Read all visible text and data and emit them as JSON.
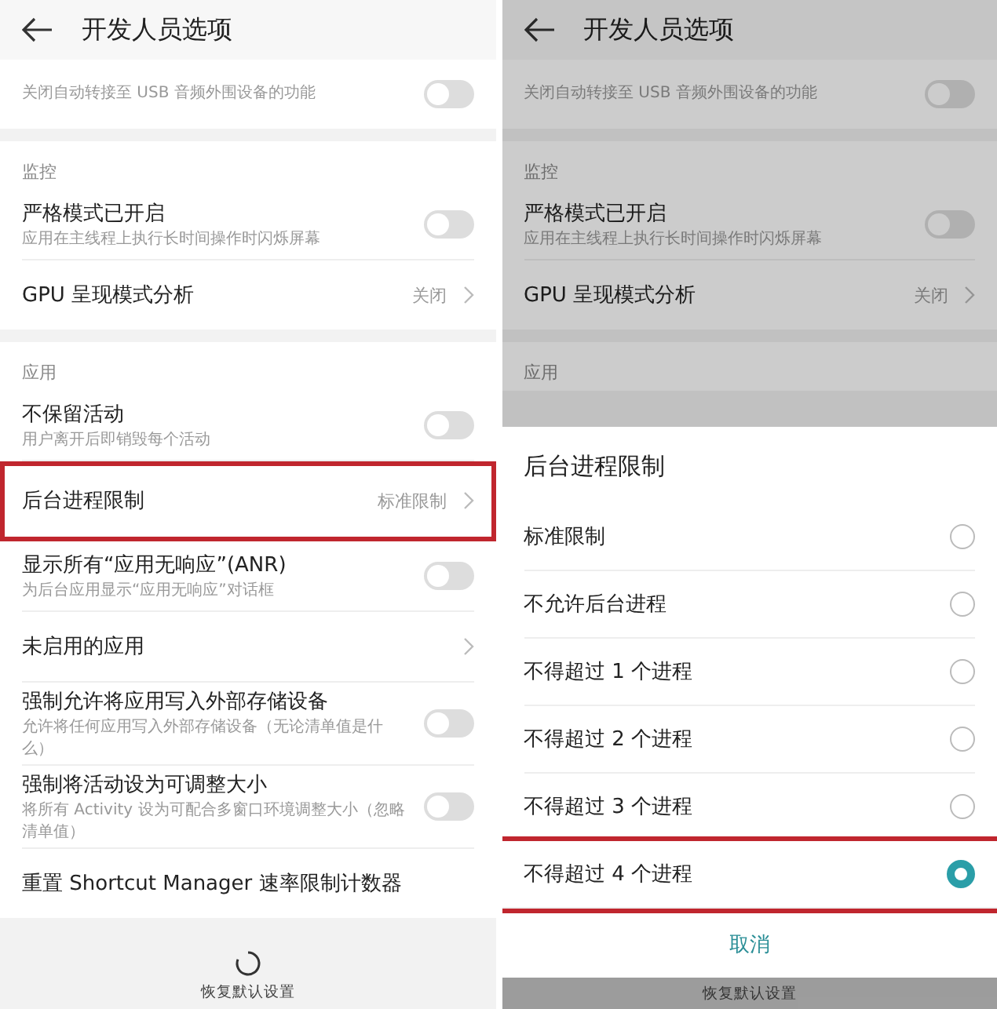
{
  "panels": [
    {
      "title": "开发人员选项",
      "groups": [
        {
          "items": [
            {
              "kind": "toggle",
              "subtitle": "关闭自动转接至 USB 音频外围设备的功能",
              "on": false,
              "highlighted": false
            }
          ]
        },
        {
          "label": "监控",
          "items": [
            {
              "kind": "toggle",
              "title": "严格模式已开启",
              "subtitle": "应用在主线程上执行长时间操作时闪烁屏幕",
              "on": false,
              "highlighted": false
            },
            {
              "kind": "value",
              "title": "GPU 呈现模式分析",
              "value": "关闭",
              "highlighted": false
            }
          ]
        },
        {
          "label": "应用",
          "items": [
            {
              "kind": "toggle",
              "title": "不保留活动",
              "subtitle": "用户离开后即销毁每个活动",
              "on": false,
              "highlighted": false
            },
            {
              "kind": "value",
              "title": "后台进程限制",
              "value": "标准限制",
              "highlighted": true
            },
            {
              "kind": "toggle",
              "title": "显示所有“应用无响应”(ANR)",
              "subtitle": "为后台应用显示“应用无响应”对话框",
              "on": false,
              "highlighted": false
            },
            {
              "kind": "link",
              "title": "未启用的应用",
              "highlighted": false
            },
            {
              "kind": "toggle",
              "title": "强制允许将应用写入外部存储设备",
              "subtitle": "允许将任何应用写入外部存储设备（无论清单值是什么）",
              "on": false,
              "highlighted": false
            },
            {
              "kind": "toggle",
              "title": "强制将活动设为可调整大小",
              "subtitle": "将所有 Activity 设为可配合多窗口环境调整大小（忽略清单值）",
              "on": false,
              "highlighted": false
            },
            {
              "kind": "plain",
              "title": "重置 Shortcut Manager 速率限制计数器",
              "highlighted": false
            }
          ]
        }
      ],
      "footer": {
        "label": "恢复默认设置"
      }
    },
    {
      "title": "开发人员选项",
      "dimmed": true,
      "groups": [
        {
          "items": [
            {
              "kind": "toggle",
              "subtitle": "关闭自动转接至 USB 音频外围设备的功能",
              "on": false,
              "highlighted": false
            }
          ]
        },
        {
          "label": "监控",
          "items": [
            {
              "kind": "toggle",
              "title": "严格模式已开启",
              "subtitle": "应用在主线程上执行长时间操作时闪烁屏幕",
              "on": false,
              "highlighted": false
            },
            {
              "kind": "value",
              "title": "GPU 呈现模式分析",
              "value": "关闭",
              "highlighted": false
            }
          ]
        },
        {
          "label": "应用"
        }
      ],
      "dialog": {
        "title": "后台进程限制",
        "options": [
          {
            "label": "标准限制",
            "selected": false,
            "highlighted": false
          },
          {
            "label": "不允许后台进程",
            "selected": false,
            "highlighted": false
          },
          {
            "label": "不得超过 1 个进程",
            "selected": false,
            "highlighted": false
          },
          {
            "label": "不得超过 2 个进程",
            "selected": false,
            "highlighted": false
          },
          {
            "label": "不得超过 3 个进程",
            "selected": false,
            "highlighted": false
          },
          {
            "label": "不得超过 4 个进程",
            "selected": true,
            "highlighted": true
          }
        ],
        "cancel": "取消"
      },
      "footer": {
        "label": "恢复默认设置"
      }
    }
  ]
}
